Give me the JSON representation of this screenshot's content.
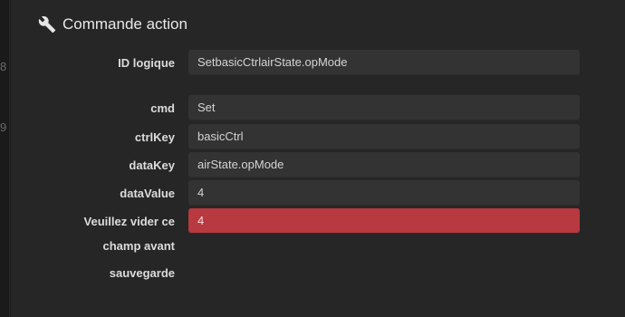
{
  "gutter": {
    "numbers": [
      "8",
      "9"
    ]
  },
  "header": {
    "title": "Commande action",
    "icon": "wrench-icon"
  },
  "form": {
    "logical_id": {
      "label": "ID logique",
      "value": "SetbasicCtrlairState.opMode"
    },
    "cmd": {
      "label": "cmd",
      "value": "Set"
    },
    "ctrlKey": {
      "label": "ctrlKey",
      "value": "basicCtrl"
    },
    "dataKey": {
      "label": "dataKey",
      "value": "airState.opMode"
    },
    "dataValue": {
      "label": "dataValue",
      "value": "4"
    },
    "clear_field": {
      "label_lines": [
        "Veuillez vider ce",
        "champ avant",
        "sauvegarde"
      ],
      "value": "4"
    }
  },
  "colors": {
    "background": "#262627",
    "field": "#333334",
    "error_field": "#b8393f",
    "text": "#dcdcdc"
  }
}
